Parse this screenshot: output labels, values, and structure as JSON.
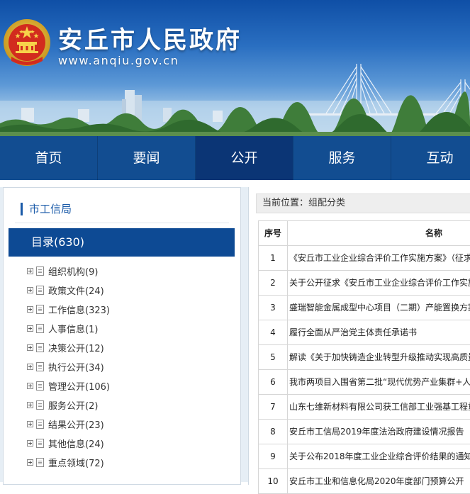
{
  "site": {
    "title": "安丘市人民政府",
    "url": "www.anqiu.gov.cn"
  },
  "nav": {
    "items": [
      {
        "label": "首页"
      },
      {
        "label": "要闻"
      },
      {
        "label": "公开"
      },
      {
        "label": "服务"
      },
      {
        "label": "互动"
      }
    ],
    "active_index": 2
  },
  "sidebar": {
    "department": "市工信局",
    "catalog_label": "目录(630)",
    "items": [
      {
        "label": "组织机构(9)"
      },
      {
        "label": "政策文件(24)"
      },
      {
        "label": "工作信息(323)"
      },
      {
        "label": "人事信息(1)"
      },
      {
        "label": "决策公开(12)"
      },
      {
        "label": "执行公开(34)"
      },
      {
        "label": "管理公开(106)"
      },
      {
        "label": "服务公开(2)"
      },
      {
        "label": "结果公开(23)"
      },
      {
        "label": "其他信息(24)"
      },
      {
        "label": "重点领域(72)"
      }
    ]
  },
  "main": {
    "breadcrumb": "当前位置：组配分类",
    "table": {
      "headers": {
        "no": "序号",
        "name": "名称"
      },
      "rows": [
        {
          "no": "1",
          "name": "《安丘市工业企业综合评价工作实施方案》（征求"
        },
        {
          "no": "2",
          "name": "关于公开征求《安丘市工业企业综合评价工作实施"
        },
        {
          "no": "3",
          "name": "盛瑞智能金属成型中心项目（二期）产能置换方案"
        },
        {
          "no": "4",
          "name": "履行全面从严治党主体责任承诺书"
        },
        {
          "no": "5",
          "name": "解读《关于加快铸造企业转型升级推动实现高质量"
        },
        {
          "no": "6",
          "name": "我市两项目入围省第二批“现代优势产业集群+人"
        },
        {
          "no": "7",
          "name": "山东七维新材料有限公司获工信部工业强基工程重"
        },
        {
          "no": "8",
          "name": "安丘市工信局2019年度法治政府建设情况报告"
        },
        {
          "no": "9",
          "name": "关于公布2018年度工业企业综合评价结果的通知"
        },
        {
          "no": "10",
          "name": "安丘市工业和信息化局2020年度部门预算公开"
        }
      ]
    }
  },
  "colors": {
    "nav_bg": "#124d91",
    "nav_active": "#0b3575",
    "catalog_bg": "#0d4a94",
    "accent": "#1a5aa8"
  }
}
